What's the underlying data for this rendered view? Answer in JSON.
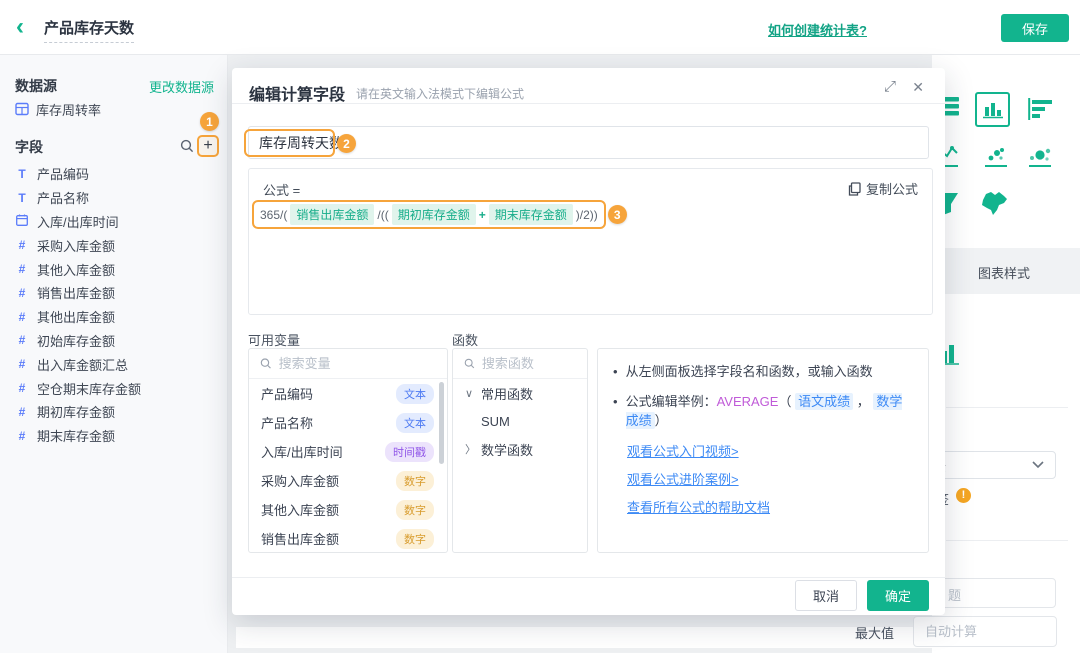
{
  "header": {
    "back_icon": "‹",
    "title": "产品库存天数",
    "help_link": "如何创建统计表?",
    "save_button": "保存"
  },
  "sidebar": {
    "datasource_label": "数据源",
    "change_datasource_link": "更改数据源",
    "datasource_item": "库存周转率",
    "fields_label": "字段",
    "add_field_button": "+",
    "fields": [
      {
        "name": "产品编码",
        "type": "text"
      },
      {
        "name": "产品名称",
        "type": "text"
      },
      {
        "name": "入库/出库时间",
        "type": "date"
      },
      {
        "name": "采购入库金额",
        "type": "number"
      },
      {
        "name": "其他入库金额",
        "type": "number"
      },
      {
        "name": "销售出库金额",
        "type": "number"
      },
      {
        "name": "其他出库金额",
        "type": "number"
      },
      {
        "name": "初始库存金额",
        "type": "number"
      },
      {
        "name": "出入库金额汇总",
        "type": "number"
      },
      {
        "name": "空仓期末库存金额",
        "type": "number"
      },
      {
        "name": "期初库存金额",
        "type": "number"
      },
      {
        "name": "期末库存金额",
        "type": "number"
      }
    ]
  },
  "annotations": {
    "step1": "1",
    "step2": "2",
    "step3": "3"
  },
  "modal": {
    "title": "编辑计算字段",
    "subtitle": "请在英文输入法模式下编辑公式",
    "expand_icon": "⤢",
    "close_icon": "✕",
    "field_name_value": "库存周转天数",
    "formula_label": "公式 =",
    "copy_button": "复制公式",
    "formula_tokens": [
      {
        "type": "op",
        "text": "365/("
      },
      {
        "type": "field",
        "text": "销售出库金额"
      },
      {
        "type": "op",
        "text": "/(("
      },
      {
        "type": "plus",
        "text": "+",
        "before": false
      },
      {
        "type": "field",
        "text": "期初库存金额"
      },
      {
        "type": "plus",
        "text": "+"
      },
      {
        "type": "field",
        "text": "期末库存金额"
      },
      {
        "type": "op",
        "text": ")/2))"
      }
    ],
    "variables": {
      "label": "可用变量",
      "search_placeholder": "搜索变量",
      "items": [
        {
          "name": "产品编码",
          "badge": "文本",
          "badge_type": "text"
        },
        {
          "name": "产品名称",
          "badge": "文本",
          "badge_type": "text"
        },
        {
          "name": "入库/出库时间",
          "badge": "时间戳",
          "badge_type": "time"
        },
        {
          "name": "采购入库金额",
          "badge": "数字",
          "badge_type": "number"
        },
        {
          "name": "其他入库金额",
          "badge": "数字",
          "badge_type": "number"
        },
        {
          "name": "销售出库金额",
          "badge": "数字",
          "badge_type": "number"
        }
      ]
    },
    "functions": {
      "label": "函数",
      "search_placeholder": "搜索函数",
      "tree": [
        {
          "label": "常用函数",
          "expanded": true,
          "children": [
            "SUM"
          ]
        },
        {
          "label": "数学函数",
          "expanded": false,
          "children": []
        }
      ]
    },
    "help": {
      "bullet1": "从左侧面板选择字段名和函数，或输入函数",
      "example_prefix": "公式编辑举例：",
      "example_function": "AVERAGE",
      "example_open_paren": "（",
      "example_field1": "语文成绩",
      "example_comma": "，",
      "example_field2": "数学成绩",
      "example_close_paren": "）",
      "links": [
        "观看公式入门视频>",
        "观看公式进阶案例>",
        "查看所有公式的帮助文档"
      ]
    },
    "cancel_button": "取消",
    "ok_button": "确定"
  },
  "right_panel": {
    "style_tab": "图表样式",
    "chart_type_icons": [
      "table-chart-icon",
      "bar-chart-icon",
      "horizontal-bar-chart-icon",
      "combo-chart-icon",
      "scatter-chart-icon",
      "bubble-chart-icon",
      "funnel-chart-icon",
      "china-map-chart-icon"
    ],
    "selected_chart_type": "bar-chart-icon",
    "dropdown_text_fragment": "示",
    "label_fragment": "签",
    "warning_icon": "!",
    "input_fragment": "题",
    "max_value_label": "最大值",
    "max_value_placeholder": "自动计算"
  },
  "colors": {
    "accent_teal": "#12b48e",
    "annotation_orange": "#f6a43b",
    "link_blue": "#3d8af5",
    "field_icon_blue": "#5b7cfa",
    "warning_orange": "#f5a623"
  }
}
